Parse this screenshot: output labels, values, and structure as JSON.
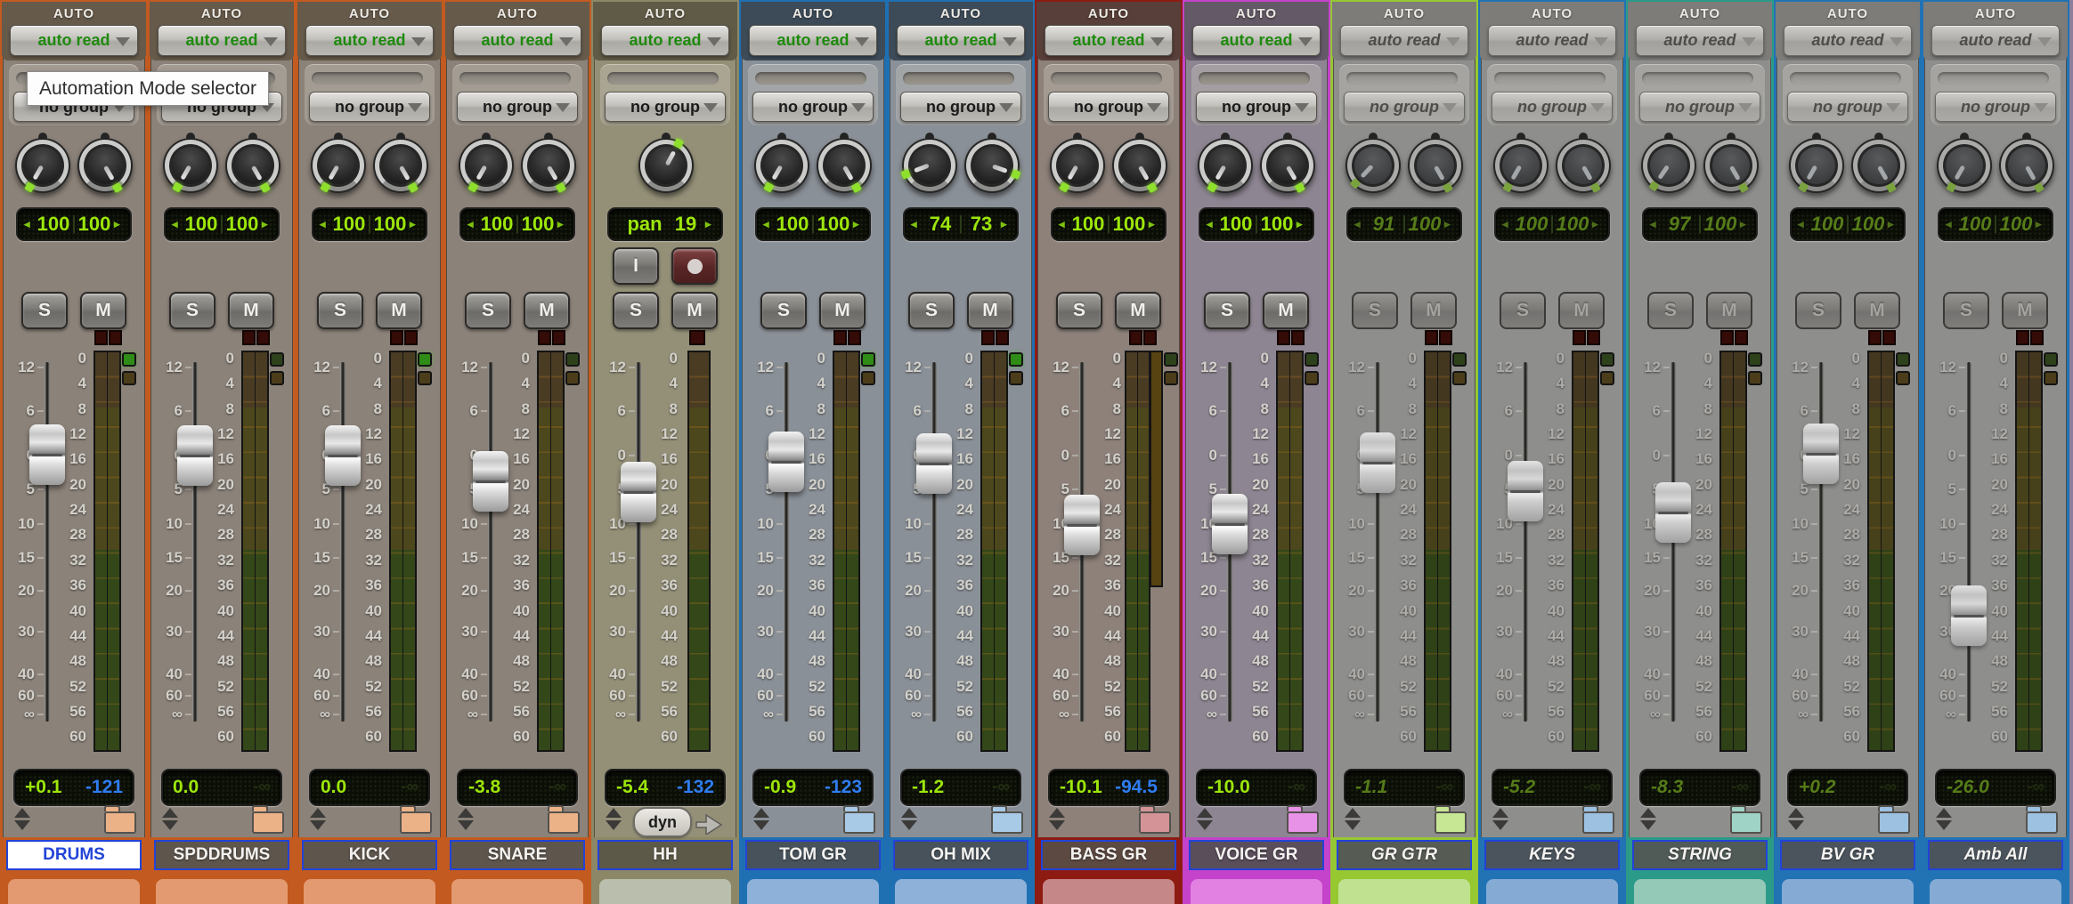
{
  "tooltip": "Automation Mode selector",
  "labels": {
    "auto": "AUTO",
    "solo": "S",
    "mute": "M",
    "input": "I",
    "dyn": "dyn",
    "pan_left_arrow": "◂",
    "pan_right_arrow": "▸"
  },
  "fader_scale": [
    "12",
    "6",
    "0",
    "5",
    "10",
    "15",
    "20",
    "30",
    "40",
    "60",
    "∞"
  ],
  "meter_scale": [
    "0",
    "4",
    "8",
    "12",
    "16",
    "20",
    "24",
    "28",
    "32",
    "36",
    "40",
    "44",
    "48",
    "52",
    "56",
    "60"
  ],
  "channels": [
    {
      "name": "DRUMS",
      "mode": "auto read",
      "group": "no group",
      "pan_l": "100",
      "pan_r": "100",
      "vol": "+0.1",
      "peak": "-121",
      "peak_blue": true,
      "fader_db": 0.1,
      "active": true,
      "selected": true,
      "muted": false,
      "mono": false,
      "rec": false,
      "dyn": false,
      "squares": "bright",
      "gr_bar": false,
      "colors": {
        "c": "#c35a1f",
        "body": "#8b8279",
        "hdr": "#665a4b",
        "band": "#e39a71",
        "nbg": "#5e564d",
        "folder": "#ecb287"
      }
    },
    {
      "name": "SPDDRUMS",
      "mode": "auto read",
      "group": "no group",
      "pan_l": "100",
      "pan_r": "100",
      "vol": "0.0",
      "peak": "-∞",
      "peak_blue": false,
      "fader_db": 0.0,
      "active": true,
      "selected": false,
      "muted": false,
      "mono": false,
      "rec": false,
      "dyn": false,
      "squares": "dim",
      "gr_bar": false,
      "colors": {
        "c": "#c35a1f",
        "body": "#8b8279",
        "hdr": "#665a4b",
        "band": "#e39a71",
        "nbg": "#5e564d",
        "folder": "#ecb287"
      }
    },
    {
      "name": "KICK",
      "mode": "auto read",
      "group": "no group",
      "pan_l": "100",
      "pan_r": "100",
      "vol": "0.0",
      "peak": "-∞",
      "peak_blue": false,
      "fader_db": 0.0,
      "active": true,
      "selected": false,
      "muted": false,
      "mono": false,
      "rec": false,
      "dyn": false,
      "squares": "bright",
      "gr_bar": false,
      "colors": {
        "c": "#c35a1f",
        "body": "#8b8279",
        "hdr": "#665a4b",
        "band": "#e39a71",
        "nbg": "#5e564d",
        "folder": "#ecb287"
      }
    },
    {
      "name": "SNARE",
      "mode": "auto read",
      "group": "no group",
      "pan_l": "100",
      "pan_r": "100",
      "vol": "-3.8",
      "peak": "-∞",
      "peak_blue": false,
      "fader_db": -3.8,
      "active": true,
      "selected": false,
      "muted": false,
      "mono": false,
      "rec": false,
      "dyn": false,
      "squares": "dim",
      "gr_bar": false,
      "colors": {
        "c": "#c35a1f",
        "body": "#8b8279",
        "hdr": "#665a4b",
        "band": "#e39a71",
        "nbg": "#5e564d",
        "folder": "#ecb287"
      }
    },
    {
      "name": "HH",
      "mode": "auto read",
      "group": "no group",
      "pan_l": "pan",
      "pan_r": "19",
      "mono_pan": 19,
      "vol": "-5.4",
      "peak": "-132",
      "peak_blue": true,
      "fader_db": -5.4,
      "active": true,
      "selected": false,
      "muted": false,
      "mono": true,
      "rec": true,
      "dyn": true,
      "squares": "none",
      "gr_bar": false,
      "colors": {
        "c": "#8c8766",
        "body": "#949078",
        "hdr": "#5f5b46",
        "band": "#b9bead",
        "nbg": "#5c5948",
        "folder": "#c8c4b0"
      }
    },
    {
      "name": "TOM GR",
      "mode": "auto read",
      "group": "no group",
      "pan_l": "100",
      "pan_r": "100",
      "vol": "-0.9",
      "peak": "-123",
      "peak_blue": true,
      "fader_db": -0.9,
      "active": true,
      "selected": false,
      "muted": false,
      "mono": false,
      "rec": false,
      "dyn": false,
      "squares": "bright",
      "gr_bar": false,
      "colors": {
        "c": "#1f70b2",
        "body": "#8a9097",
        "hdr": "#3d4b59",
        "band": "#8db1d9",
        "nbg": "#48525b",
        "folder": "#a9cae6"
      }
    },
    {
      "name": "OH MIX",
      "mode": "auto read",
      "group": "no group",
      "pan_l": "74",
      "pan_r": "73",
      "vol": "-1.2",
      "peak": "-∞",
      "peak_blue": false,
      "fader_db": -1.2,
      "active": true,
      "selected": false,
      "muted": false,
      "mono": false,
      "rec": false,
      "dyn": false,
      "squares": "bright",
      "gr_bar": false,
      "colors": {
        "c": "#1f70b2",
        "body": "#8a9097",
        "hdr": "#3d4b59",
        "band": "#8db1d9",
        "nbg": "#48525b",
        "folder": "#a9cae6"
      }
    },
    {
      "name": "BASS GR",
      "mode": "auto read",
      "group": "no group",
      "pan_l": "100",
      "pan_r": "100",
      "vol": "-10.1",
      "peak": "-94.5",
      "peak_blue": true,
      "fader_db": -10.1,
      "active": true,
      "selected": false,
      "muted": false,
      "mono": false,
      "rec": false,
      "dyn": false,
      "squares": "dim",
      "gr_bar": true,
      "colors": {
        "c": "#8e1b12",
        "body": "#8d817a",
        "hdr": "#593f39",
        "band": "#c68788",
        "nbg": "#5c4942",
        "folder": "#d49497"
      }
    },
    {
      "name": "VOICE GR",
      "mode": "auto read",
      "group": "no group",
      "pan_l": "100",
      "pan_r": "100",
      "vol": "-10.0",
      "peak": "-∞",
      "peak_blue": false,
      "fader_db": -10.0,
      "active": true,
      "selected": false,
      "muted": false,
      "mono": false,
      "rec": false,
      "dyn": false,
      "squares": "dim",
      "gr_bar": false,
      "colors": {
        "c": "#c443ca",
        "body": "#8d8591",
        "hdr": "#635967",
        "band": "#e281e2",
        "nbg": "#5a4e5b",
        "folder": "#e792e7"
      }
    },
    {
      "name": "GR GTR",
      "mode": "auto read",
      "group": "no group",
      "pan_l": "91",
      "pan_r": "100",
      "vol": "-1.1",
      "peak": "-∞",
      "peak_blue": false,
      "fader_db": -1.1,
      "active": false,
      "selected": false,
      "muted": true,
      "mono": false,
      "rec": false,
      "dyn": false,
      "squares": "dim",
      "gr_bar": false,
      "colors": {
        "c": "#97c832",
        "body": "#8e8e8c",
        "hdr": "#7d7c79",
        "band": "#c0e18f",
        "nbg": "#565b53",
        "folder": "#c7e795"
      }
    },
    {
      "name": "KEYS",
      "mode": "auto read",
      "group": "no group",
      "pan_l": "100",
      "pan_r": "100",
      "vol": "-5.2",
      "peak": "-∞",
      "peak_blue": false,
      "fader_db": -5.2,
      "active": false,
      "selected": false,
      "muted": false,
      "mono": false,
      "rec": false,
      "dyn": false,
      "squares": "dim",
      "gr_bar": false,
      "colors": {
        "c": "#2173b4",
        "body": "#8e8e8c",
        "hdr": "#7d7c79",
        "band": "#85abd5",
        "nbg": "#4b545d",
        "folder": "#9dc1e1"
      }
    },
    {
      "name": "STRING",
      "mode": "auto read",
      "group": "no group",
      "pan_l": "97",
      "pan_r": "100",
      "vol": "-8.3",
      "peak": "-∞",
      "peak_blue": false,
      "fader_db": -8.3,
      "active": false,
      "selected": false,
      "muted": true,
      "mono": false,
      "rec": false,
      "dyn": false,
      "squares": "dim",
      "gr_bar": false,
      "colors": {
        "c": "#2b9a88",
        "body": "#8e8e8c",
        "hdr": "#7d7c79",
        "band": "#94c8b7",
        "nbg": "#505a56",
        "folder": "#9fd3c5"
      }
    },
    {
      "name": "BV GR",
      "mode": "auto read",
      "group": "no group",
      "pan_l": "100",
      "pan_r": "100",
      "vol": "+0.2",
      "peak": "-∞",
      "peak_blue": false,
      "fader_db": 0.2,
      "active": false,
      "selected": false,
      "muted": false,
      "mono": false,
      "rec": false,
      "dyn": false,
      "squares": "dim",
      "gr_bar": false,
      "colors": {
        "c": "#2173b4",
        "body": "#8e8e8c",
        "hdr": "#7d7c79",
        "band": "#85abd5",
        "nbg": "#4b545d",
        "folder": "#9dc1e1"
      }
    },
    {
      "name": "Amb All",
      "mode": "auto read",
      "group": "no group",
      "pan_l": "100",
      "pan_r": "100",
      "vol": "-26.0",
      "peak": "-∞",
      "peak_blue": false,
      "fader_db": -26.0,
      "active": false,
      "selected": false,
      "muted": false,
      "mono": false,
      "rec": false,
      "dyn": false,
      "squares": "dim",
      "gr_bar": false,
      "colors": {
        "c": "#2173b4",
        "body": "#8e8e8c",
        "hdr": "#7d7c79",
        "band": "#85abd5",
        "nbg": "#4b545d",
        "folder": "#9dc1e1"
      }
    }
  ]
}
